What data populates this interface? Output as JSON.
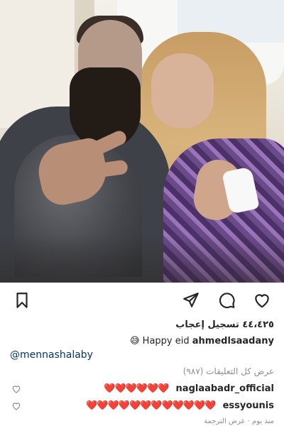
{
  "post": {
    "likes_text": "٤٤،٤٢٥ تسجيل إعجاب",
    "caption_emoji": "😅",
    "caption_text": "Happy eid",
    "caption_user": "ahmedlsaadany",
    "mention": "@mennashalaby",
    "view_comments": "عرض كل التعليقات (٩٨٧)"
  },
  "comments": [
    {
      "user": "naglaabadr_official",
      "text": "❤️❤️❤️❤️❤️❤️"
    },
    {
      "user": "essyounis",
      "text": "❤️❤️❤️❤️❤️❤️❤️❤️❤️❤️❤️❤️"
    }
  ],
  "footer": "منذ يوم · عرض الترجمة",
  "icons": {
    "bookmark": "bookmark-icon",
    "share": "share-icon",
    "comment": "comment-icon",
    "like": "heart-icon"
  },
  "colors": {
    "heart_red": "#e0102a",
    "mention_blue": "#00376b",
    "muted": "#8e8e8e"
  }
}
